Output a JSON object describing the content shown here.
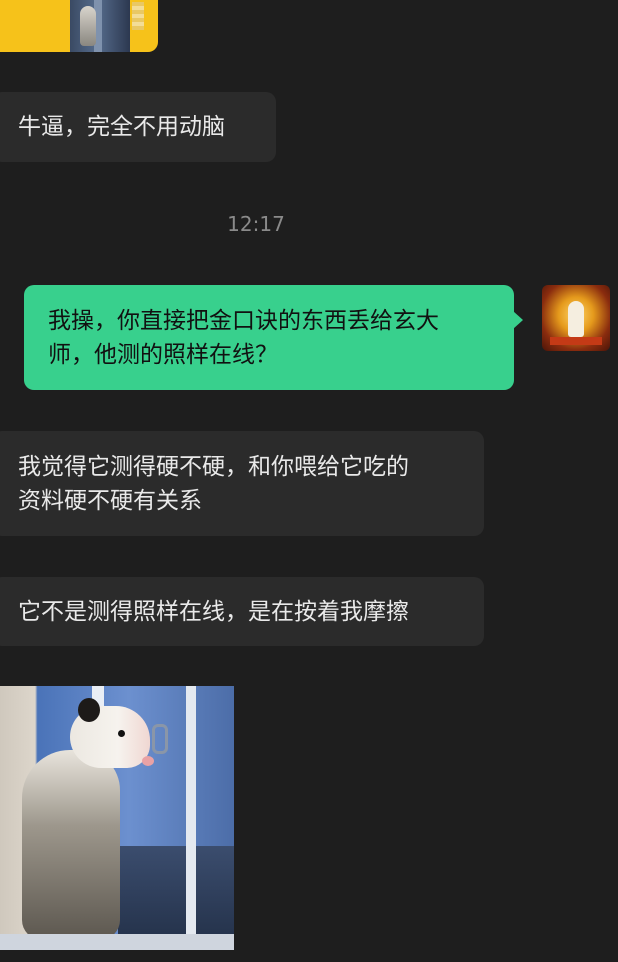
{
  "messages": {
    "received_1": "牛逼，完全不用动脑",
    "timestamp": "12:17",
    "sent_1": "我操，你直接把金口诀的东西丢给玄大\n师，他测的照样在线？",
    "received_2": "我觉得它测得硬不硬，和你喂给它吃的\n资料硬不硬有关系",
    "received_3": "它不是测得照样在线，是在按着我摩擦"
  },
  "colors": {
    "background": "#1e1e1e",
    "received_bubble": "#2b2b2b",
    "sent_bubble": "#38d08d",
    "timestamp_text": "#8a8a8a"
  }
}
